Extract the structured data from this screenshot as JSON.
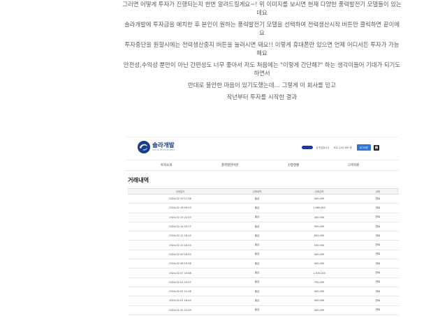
{
  "article": {
    "paragraphs": [
      [
        "그러면 어떻게 투자가 진행되는지 한번 알려드릴게요~! 위 이미지를 보시면 현재 다양한 풍력발전기 모델들이 있는",
        "데요"
      ],
      [
        "솔라개발에 투자금을 예치한 후 본인이 원하는 풍력발전기 모델을 선택하여 전력생산시작 버튼만 클릭하면 끝이에",
        "요"
      ],
      [
        "투자중단을 원할시에는 전력생산중지 버튼을 눌러시면 돼요!! 이렇게 휴대폰만 있으면 언제 어디서든 투자가 가능",
        "해요"
      ],
      [
        "안전성,수익성 뿐만이 아닌 간편성도 너무 좋아서 저도 처음에는 \"이렇게 간단해?\" 하는 생각이들어 기대가 되기도",
        "하면서"
      ],
      [
        "반대로 불안한 마음이 있기도했는데… 그렇게 이 회사를 믿고"
      ],
      [
        "작년부터 투자를 시작한 결과"
      ]
    ]
  },
  "screenshot": {
    "logo": {
      "name": "솔라개발",
      "sub": "SOLAR DEVELOPMENT"
    },
    "account": {
      "label": "님 반갑습니다",
      "balance": "831,105,360 원",
      "button": "로그아웃"
    },
    "nav": [
      "투자소개",
      "풍력발전이란",
      "신청현황",
      "고객지원"
    ],
    "title": "거래내역",
    "table": {
      "headers": [
        "신청일자",
        "신청내역",
        "신청금액",
        "상태"
      ],
      "rows": [
        [
          "2024-02-19 17:26",
          "출금",
          "400,000",
          "완료"
        ],
        [
          "2024-02-18 09:25",
          "출금",
          "1,960,000",
          "완료"
        ],
        [
          "2024-02-15 21:53",
          "출금",
          "400,000",
          "완료"
        ],
        [
          "2024-02-14 20:17",
          "출금",
          "900,000",
          "완료"
        ],
        [
          "2024-02-12 18:14",
          "출금",
          "820,000",
          "완료"
        ],
        [
          "2024-02-10 18:34",
          "출금",
          "530,000",
          "완료"
        ],
        [
          "2024-02-09 18:25",
          "출금",
          "400,000",
          "완료"
        ],
        [
          "2024-02-08 19:36",
          "출금",
          "400,000",
          "완료"
        ],
        [
          "2024-02-07 19:08",
          "출금",
          "1,300,000",
          "완료"
        ],
        [
          "2024-02-04 19:07",
          "출금",
          "750,000",
          "완료"
        ],
        [
          "2024-02-02 21:16",
          "출금",
          "400,000",
          "완료"
        ],
        [
          "2024-02-01 18:44",
          "출금",
          "400,000",
          "완료"
        ],
        [
          "2024-01-31 21:09",
          "출금",
          "400,000",
          "완료"
        ]
      ]
    },
    "colors": {
      "brand": "#1b3d8c",
      "button": "#2f75d8"
    }
  }
}
